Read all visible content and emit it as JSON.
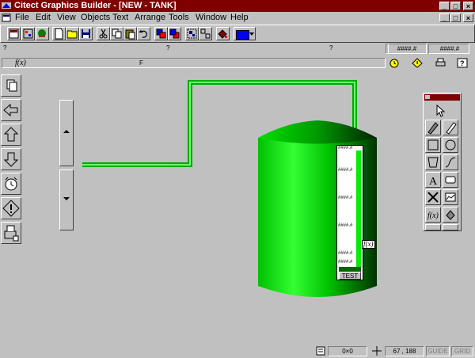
{
  "window": {
    "title": "Citect Graphics Builder - [NEW - TANK]",
    "controls": [
      "_",
      "□",
      "×"
    ],
    "child_controls": [
      "_",
      "□",
      "×"
    ]
  },
  "menu": {
    "items": [
      "File",
      "Edit",
      "View",
      "Objects",
      "Text",
      "Arrange",
      "Tools",
      "Window",
      "Help"
    ]
  },
  "toolbar": {
    "icons": [
      "properties-icon",
      "graphics-library-icon",
      "paste-symbol-icon",
      "new-icon",
      "open-icon",
      "save-icon",
      "cut-icon",
      "copy-icon",
      "paste-icon",
      "undo-icon",
      "bring-to-front-icon",
      "send-to-back-icon",
      "group-icon",
      "ungroup-icon",
      "fill-icon",
      "color-icon"
    ],
    "color": "#0000ff"
  },
  "propbar1": {
    "field1": "?",
    "field2": "?",
    "field3": "?",
    "readout1": "####.#",
    "readout2": "####.#",
    "readout3": "####.#"
  },
  "propbar2": {
    "fx": "f(x)",
    "marker1": "F",
    "marker2": "F",
    "marker3": "F"
  },
  "left_toolbar": {
    "icons": [
      "page-icon",
      "back-icon",
      "up-icon",
      "down-icon",
      "alarm-clock-icon",
      "alarm-icon",
      "printer-icon"
    ]
  },
  "canvas": {
    "tank_labels": [
      "####.#",
      "####.#",
      "####.#",
      "####.#",
      "####.#",
      "####.#"
    ],
    "tank_button_label": "TEST",
    "fx_marker": "f(x)"
  },
  "palette": {
    "tools": [
      "pointer-icon",
      "pen-icon",
      "line-icon",
      "rectangle-icon",
      "ellipse-icon",
      "polygon-icon",
      "polyline-icon",
      "text-icon",
      "button-icon",
      "symbol-set-icon",
      "trend-icon",
      "cicode-object-icon",
      "fill-level-icon",
      "pipe-icon",
      "freehand-icon"
    ],
    "accent": "#800000"
  },
  "statusbar": {
    "count": "0×0",
    "coords": "67 , 188",
    "guide": "GUIDE",
    "grid": "GRID"
  }
}
